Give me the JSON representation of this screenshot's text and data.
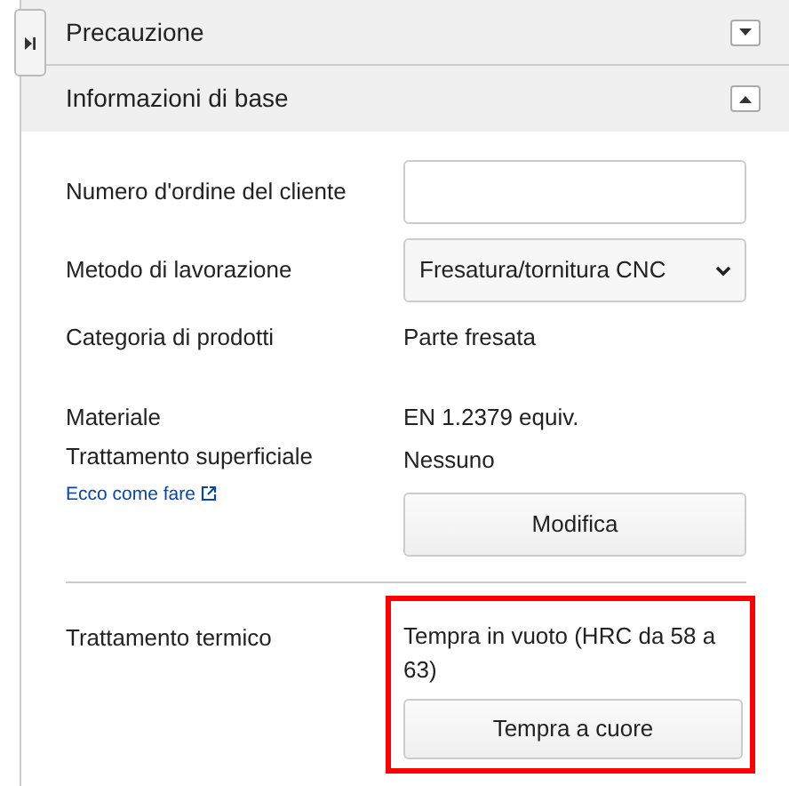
{
  "sections": [
    {
      "title": "Precauzione",
      "expanded": false
    },
    {
      "title": "Informazioni di base",
      "expanded": true
    }
  ],
  "fields": [
    {
      "kind": "input",
      "label": "Numero d'ordine del cliente"
    },
    {
      "kind": "select",
      "label": "Metodo di lavorazione",
      "value": "Fresatura/tornitura CNC"
    },
    {
      "kind": "text",
      "label": "Categoria di prodotti",
      "value": "Parte fresata"
    }
  ],
  "material": {
    "label": "Materiale",
    "value": "EN 1.2379 equiv."
  },
  "surface": {
    "label": "Trattamento superficiale",
    "link": "Ecco come fare",
    "value": "Nessuno",
    "button": "Modifica"
  },
  "heat": {
    "label": "Trattamento termico",
    "value": "Tempra in vuoto (HRC da 58 a 63)",
    "button": "Tempra a cuore",
    "highlighted": true
  }
}
